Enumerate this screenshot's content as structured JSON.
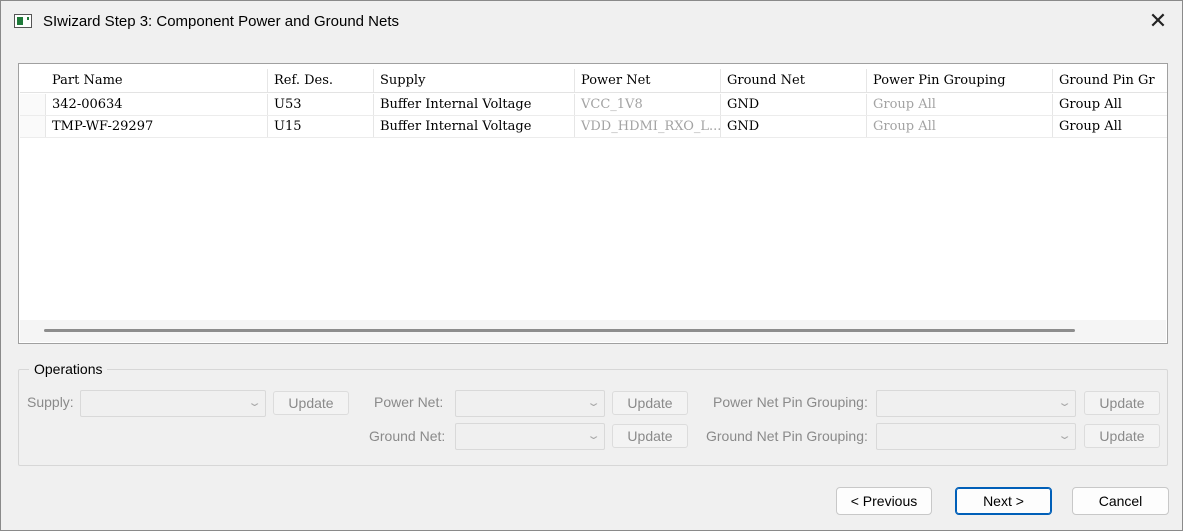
{
  "window": {
    "title": "SIwizard Step 3: Component Power and Ground Nets",
    "close_glyph": "✕"
  },
  "table": {
    "columns": [
      "Part Name",
      "Ref. Des.",
      "Supply",
      "Power Net",
      "Ground Net",
      "Power Pin Grouping",
      "Ground Pin Gr"
    ],
    "rows": [
      [
        "342-00634",
        "U53",
        "Buffer Internal Voltage",
        "VCC_1V8",
        "GND",
        "Group All",
        "Group All"
      ],
      [
        "TMP-WF-29297",
        "U15",
        "Buffer Internal Voltage",
        "VDD_HDMI_RXO_L...",
        "GND",
        "Group All",
        "Group All"
      ]
    ]
  },
  "operations": {
    "legend": "Operations",
    "supply_label": "Supply:",
    "power_net_label": "Power Net:",
    "ground_net_label": "Ground Net:",
    "power_net_pin_grouping_label": "Power Net Pin Grouping:",
    "ground_net_pin_grouping_label": "Ground Net Pin Grouping:",
    "update_label": "Update",
    "dropdown_glyph": "⌄"
  },
  "nav": {
    "previous": "< Previous",
    "next": "Next >",
    "cancel": "Cancel"
  },
  "colors": {
    "disabled_text": "#8a8a8a",
    "accent_border": "#005fb8"
  },
  "icons": [
    "app-icon",
    "close-icon",
    "chevron-down-icon"
  ]
}
